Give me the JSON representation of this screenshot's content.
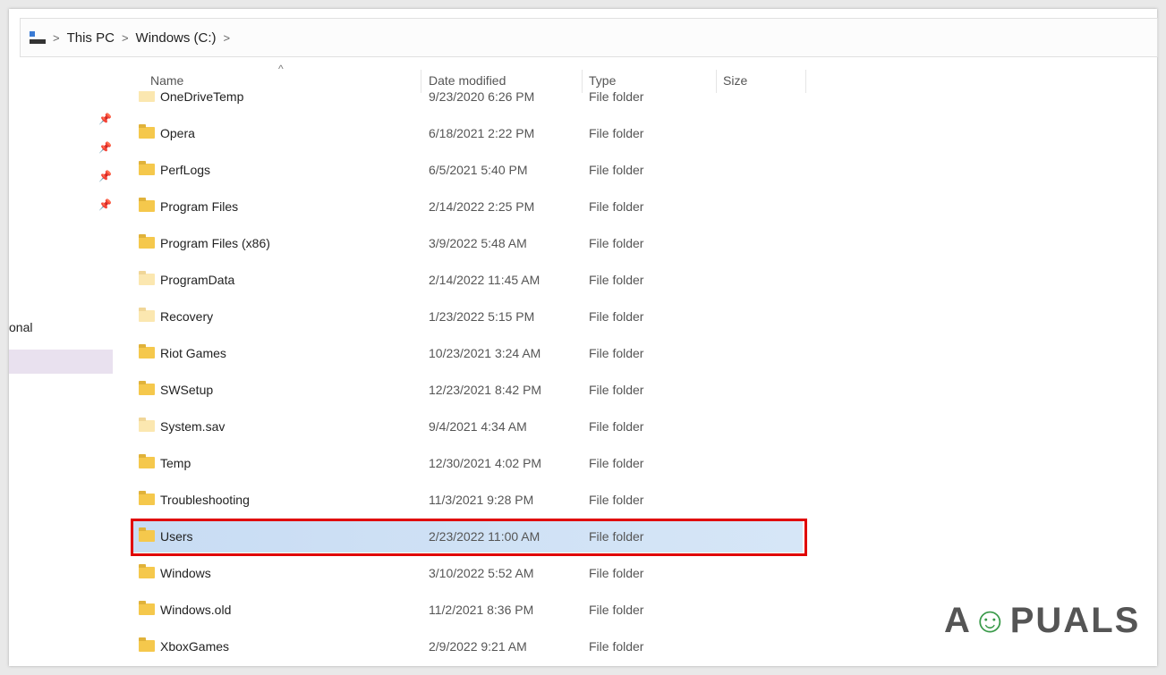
{
  "breadcrumb": [
    "This PC",
    "Windows (C:)"
  ],
  "left_pane": {
    "partial_label": "onal"
  },
  "columns": {
    "name": "Name",
    "date": "Date modified",
    "type": "Type",
    "size": "Size"
  },
  "files": [
    {
      "name": "OneDriveTemp",
      "date": "9/23/2020 6:26 PM",
      "type": "File folder"
    },
    {
      "name": "Opera",
      "date": "6/18/2021 2:22 PM",
      "type": "File folder"
    },
    {
      "name": "PerfLogs",
      "date": "6/5/2021 5:40 PM",
      "type": "File folder"
    },
    {
      "name": "Program Files",
      "date": "2/14/2022 2:25 PM",
      "type": "File folder"
    },
    {
      "name": "Program Files (x86)",
      "date": "3/9/2022 5:48 AM",
      "type": "File folder"
    },
    {
      "name": "ProgramData",
      "date": "2/14/2022 11:45 AM",
      "type": "File folder"
    },
    {
      "name": "Recovery",
      "date": "1/23/2022 5:15 PM",
      "type": "File folder"
    },
    {
      "name": "Riot Games",
      "date": "10/23/2021 3:24 AM",
      "type": "File folder"
    },
    {
      "name": "SWSetup",
      "date": "12/23/2021 8:42 PM",
      "type": "File folder"
    },
    {
      "name": "System.sav",
      "date": "9/4/2021 4:34 AM",
      "type": "File folder"
    },
    {
      "name": "Temp",
      "date": "12/30/2021 4:02 PM",
      "type": "File folder"
    },
    {
      "name": "Troubleshooting",
      "date": "11/3/2021 9:28 PM",
      "type": "File folder"
    },
    {
      "name": "Users",
      "date": "2/23/2022 11:00 AM",
      "type": "File folder"
    },
    {
      "name": "Windows",
      "date": "3/10/2022 5:52 AM",
      "type": "File folder"
    },
    {
      "name": "Windows.old",
      "date": "11/2/2021 8:36 PM",
      "type": "File folder"
    },
    {
      "name": "XboxGames",
      "date": "2/9/2022 9:21 AM",
      "type": "File folder"
    }
  ],
  "selected": "Users",
  "watermark": "APPUALS"
}
